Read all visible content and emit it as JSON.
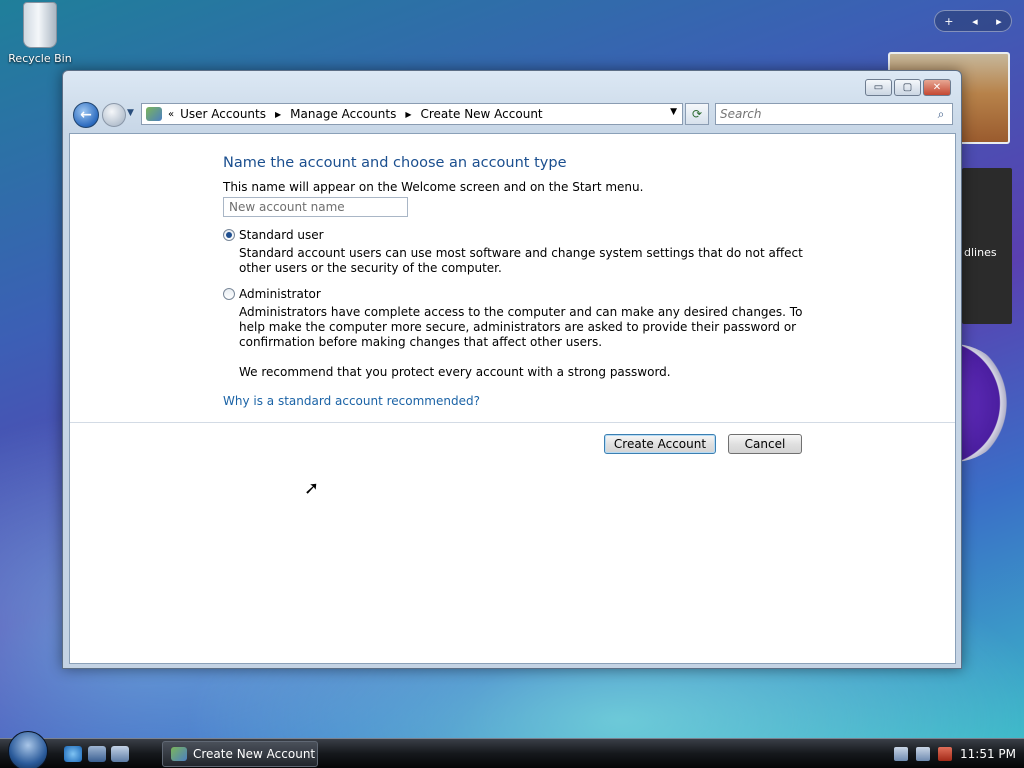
{
  "desktop": {
    "recycle_bin_label": "Recycle Bin",
    "feed_gadget_text": "dlines"
  },
  "window": {
    "caption_buttons": {
      "minimize": "▭",
      "maximize": "▢",
      "close": "✕"
    },
    "nav": {
      "back_glyph": "←",
      "history_glyph": "▼",
      "breadcrumb": [
        "User Accounts",
        "Manage Accounts",
        "Create New Account"
      ],
      "refresh_glyph": "⟳",
      "search_placeholder": "Search"
    },
    "main": {
      "title": "Name the account and choose an account type",
      "intro": "This name will appear on the Welcome screen and on the Start menu.",
      "name_placeholder": "New account name",
      "options": [
        {
          "label": "Standard user",
          "checked": true,
          "description": "Standard account users can use most software and change system settings that do not affect other users or the security of the computer."
        },
        {
          "label": "Administrator",
          "checked": false,
          "description": "Administrators have complete access to the computer and can make any desired changes. To help make the computer more secure, administrators are asked to provide their password or confirmation before making changes that affect other users."
        }
      ],
      "recommendation": "We recommend that you protect every account with a strong password.",
      "help_link": "Why is a standard account recommended?",
      "create_button": "Create Account",
      "cancel_button": "Cancel"
    }
  },
  "taskbar": {
    "task_button": "Create New Account",
    "clock": "11:51 PM"
  },
  "icons": {
    "search": "search-icon",
    "back": "back-arrow-icon",
    "refresh": "refresh-icon",
    "folder": "user-accounts-icon"
  }
}
